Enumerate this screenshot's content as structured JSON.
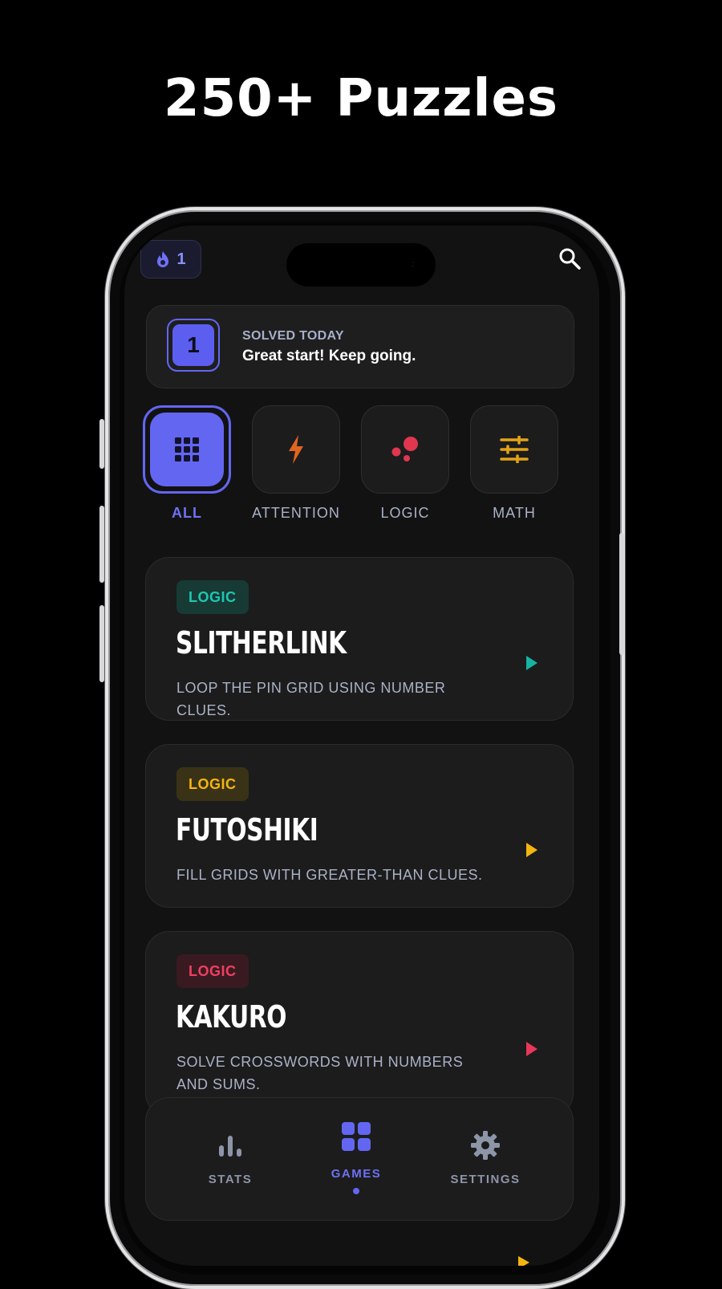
{
  "headline": "250+ Puzzles",
  "streak": {
    "count": "1"
  },
  "solved": {
    "count": "1",
    "label": "SOLVED TODAY",
    "message": "Great start! Keep going."
  },
  "categories": [
    {
      "label": "ALL",
      "icon": "grid-icon",
      "active": true
    },
    {
      "label": "ATTENTION",
      "icon": "lightning-icon",
      "color": "#e0651f"
    },
    {
      "label": "LOGIC",
      "icon": "dots-icon",
      "color": "#e0364f"
    },
    {
      "label": "MATH",
      "icon": "sliders-icon",
      "color": "#e3a317"
    }
  ],
  "puzzles": [
    {
      "tag": "LOGIC",
      "title": "SLITHERLINK",
      "description": "LOOP THE PIN GRID USING NUMBER CLUES.",
      "accent": "#16b3a2"
    },
    {
      "tag": "LOGIC",
      "title": "FUTOSHIKI",
      "description": "FILL GRIDS WITH GREATER-THAN CLUES.",
      "accent": "#f3b50f"
    },
    {
      "tag": "LOGIC",
      "title": "KAKURO",
      "description": "SOLVE CROSSWORDS WITH NUMBERS AND SUMS.",
      "accent": "#e8375a"
    }
  ],
  "tabbar": {
    "stats": "STATS",
    "games": "GAMES",
    "settings": "SETTINGS"
  },
  "colors": {
    "accent": "#6366f1",
    "background": "#121212",
    "card": "#1c1c1c"
  }
}
